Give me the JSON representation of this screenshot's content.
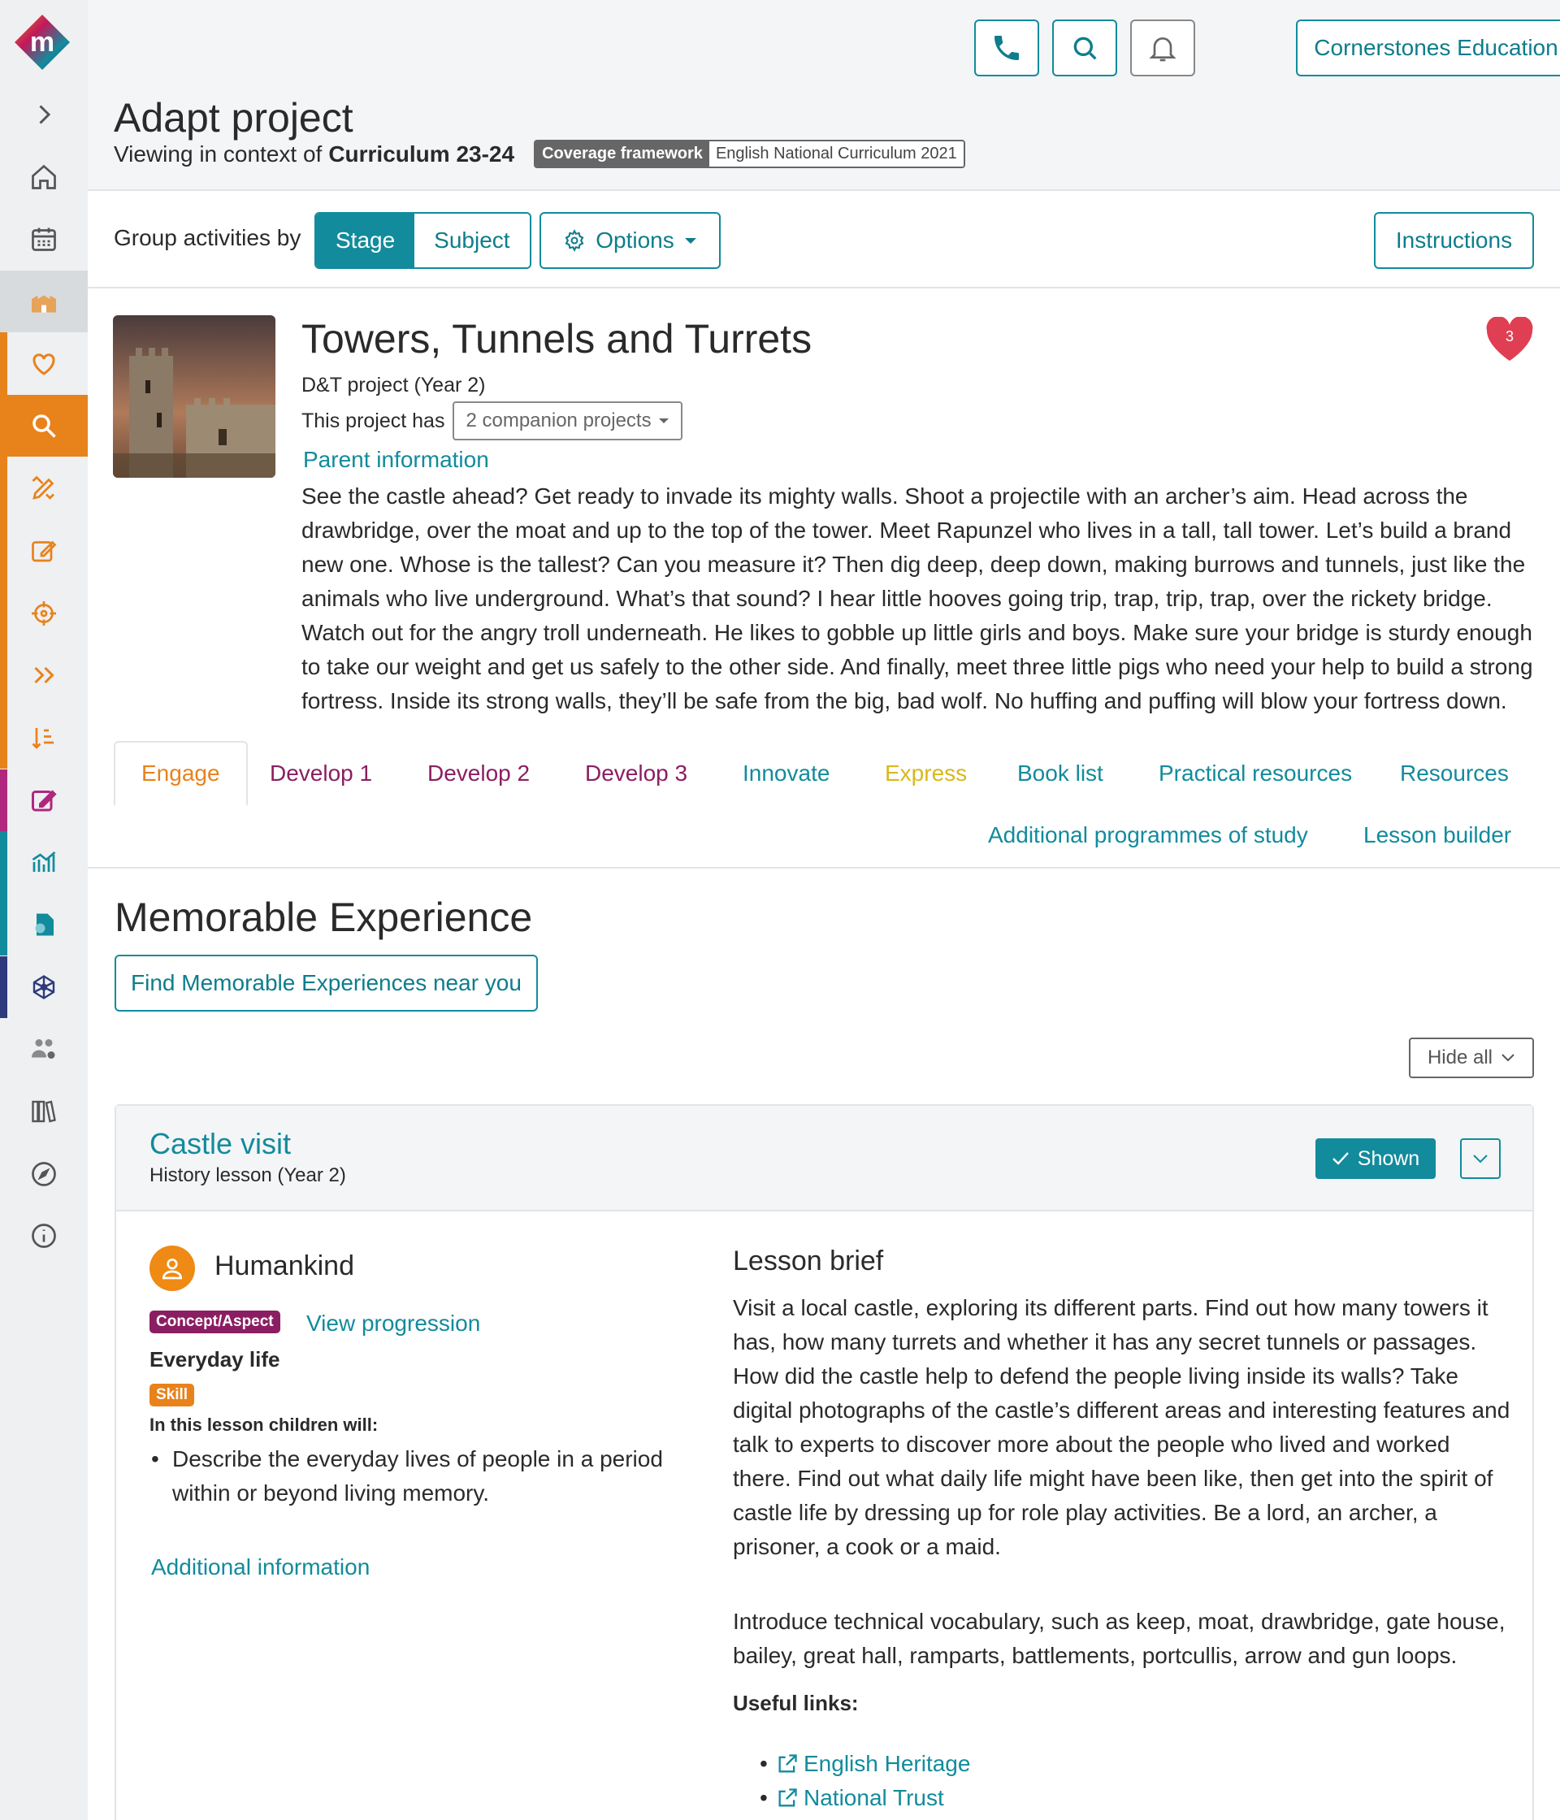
{
  "header": {
    "org_name": "Cornerstones Education",
    "page_title": "Adapt project",
    "context_prefix": "Viewing in context of",
    "context_value": "Curriculum 23-24",
    "framework_label": "Coverage framework",
    "framework_value": "English National Curriculum 2021"
  },
  "toolbar": {
    "group_label": "Group activities by",
    "stage_label": "Stage",
    "subject_label": "Subject",
    "options_label": "Options",
    "instructions_label": "Instructions"
  },
  "project": {
    "title": "Towers, Tunnels and Turrets",
    "subtitle": "D&T project (Year 2)",
    "companion_prefix": "This project has",
    "companion_label": "2 companion projects",
    "parent_info": "Parent information",
    "favourite_count": "3",
    "description": "See the castle ahead? Get ready to invade its mighty walls. Shoot a projectile with an archer’s aim. Head across the drawbridge, over the moat and up to the top of the tower. Meet Rapunzel who lives in a tall, tall tower. Let’s build a brand new one. Whose is the tallest? Can you measure it? Then dig deep, deep down, making burrows and tunnels, just like the animals who live underground. What’s that sound? I hear little hooves going trip, trap, trip, trap, over the rickety bridge. Watch out for the angry troll underneath. He likes to gobble up little girls and boys. Make sure your bridge is sturdy enough to take our weight and get us safely to the other side. And finally, meet three little pigs who need your help to build a strong fortress. Inside its strong walls, they’ll be safe from the big, bad wolf. No huffing and puffing will blow your fortress down."
  },
  "tabs": {
    "engage": "Engage",
    "develop1": "Develop 1",
    "develop2": "Develop 2",
    "develop3": "Develop 3",
    "innovate": "Innovate",
    "express": "Express",
    "booklist": "Book list",
    "practical": "Practical resources",
    "resources": "Resources",
    "additional_pos": "Additional programmes of study",
    "lesson_builder": "Lesson builder"
  },
  "memorable": {
    "title": "Memorable Experience",
    "find_button": "Find Memorable Experiences near you",
    "hide_all": "Hide all"
  },
  "lesson": {
    "title": "Castle visit",
    "subtitle": "History lesson (Year 2)",
    "shown_label": "Shown",
    "concept_name": "Humankind",
    "concept_badge": "Concept/Aspect",
    "view_progression": "View progression",
    "aspect": "Everyday life",
    "skill_badge": "Skill",
    "children_will": "In this lesson children will:",
    "outcome": "Describe the everyday lives of people in a period within or beyond living memory.",
    "additional_info": "Additional information",
    "brief_title": "Lesson brief",
    "brief_p1": "Visit a local castle, exploring its different parts. Find out how many towers it has, how many turrets and whether it has any secret tunnels or passages. How did the castle help to defend the people living inside its walls? Take digital photographs of the castle’s different areas and interesting features and talk to experts to discover more about the people who lived and worked there. Find out what daily life might have been like, then get into the spirit of castle life by dressing up for role play activities. Be a lord, an archer, a prisoner, a cook or a maid.",
    "brief_p2": "Introduce technical vocabulary, such as keep, moat, drawbridge, gate house, bailey, great hall, ramparts, battlements, portcullis, arrow and gun loops.",
    "useful_links_label": "Useful links:",
    "link1": "English Heritage",
    "link2": "National Trust"
  },
  "colors": {
    "teal": "#128b9c",
    "orange": "#e8821b",
    "purple": "#8b1e62",
    "yellow": "#d8b81e",
    "heart": "#e03e52"
  }
}
